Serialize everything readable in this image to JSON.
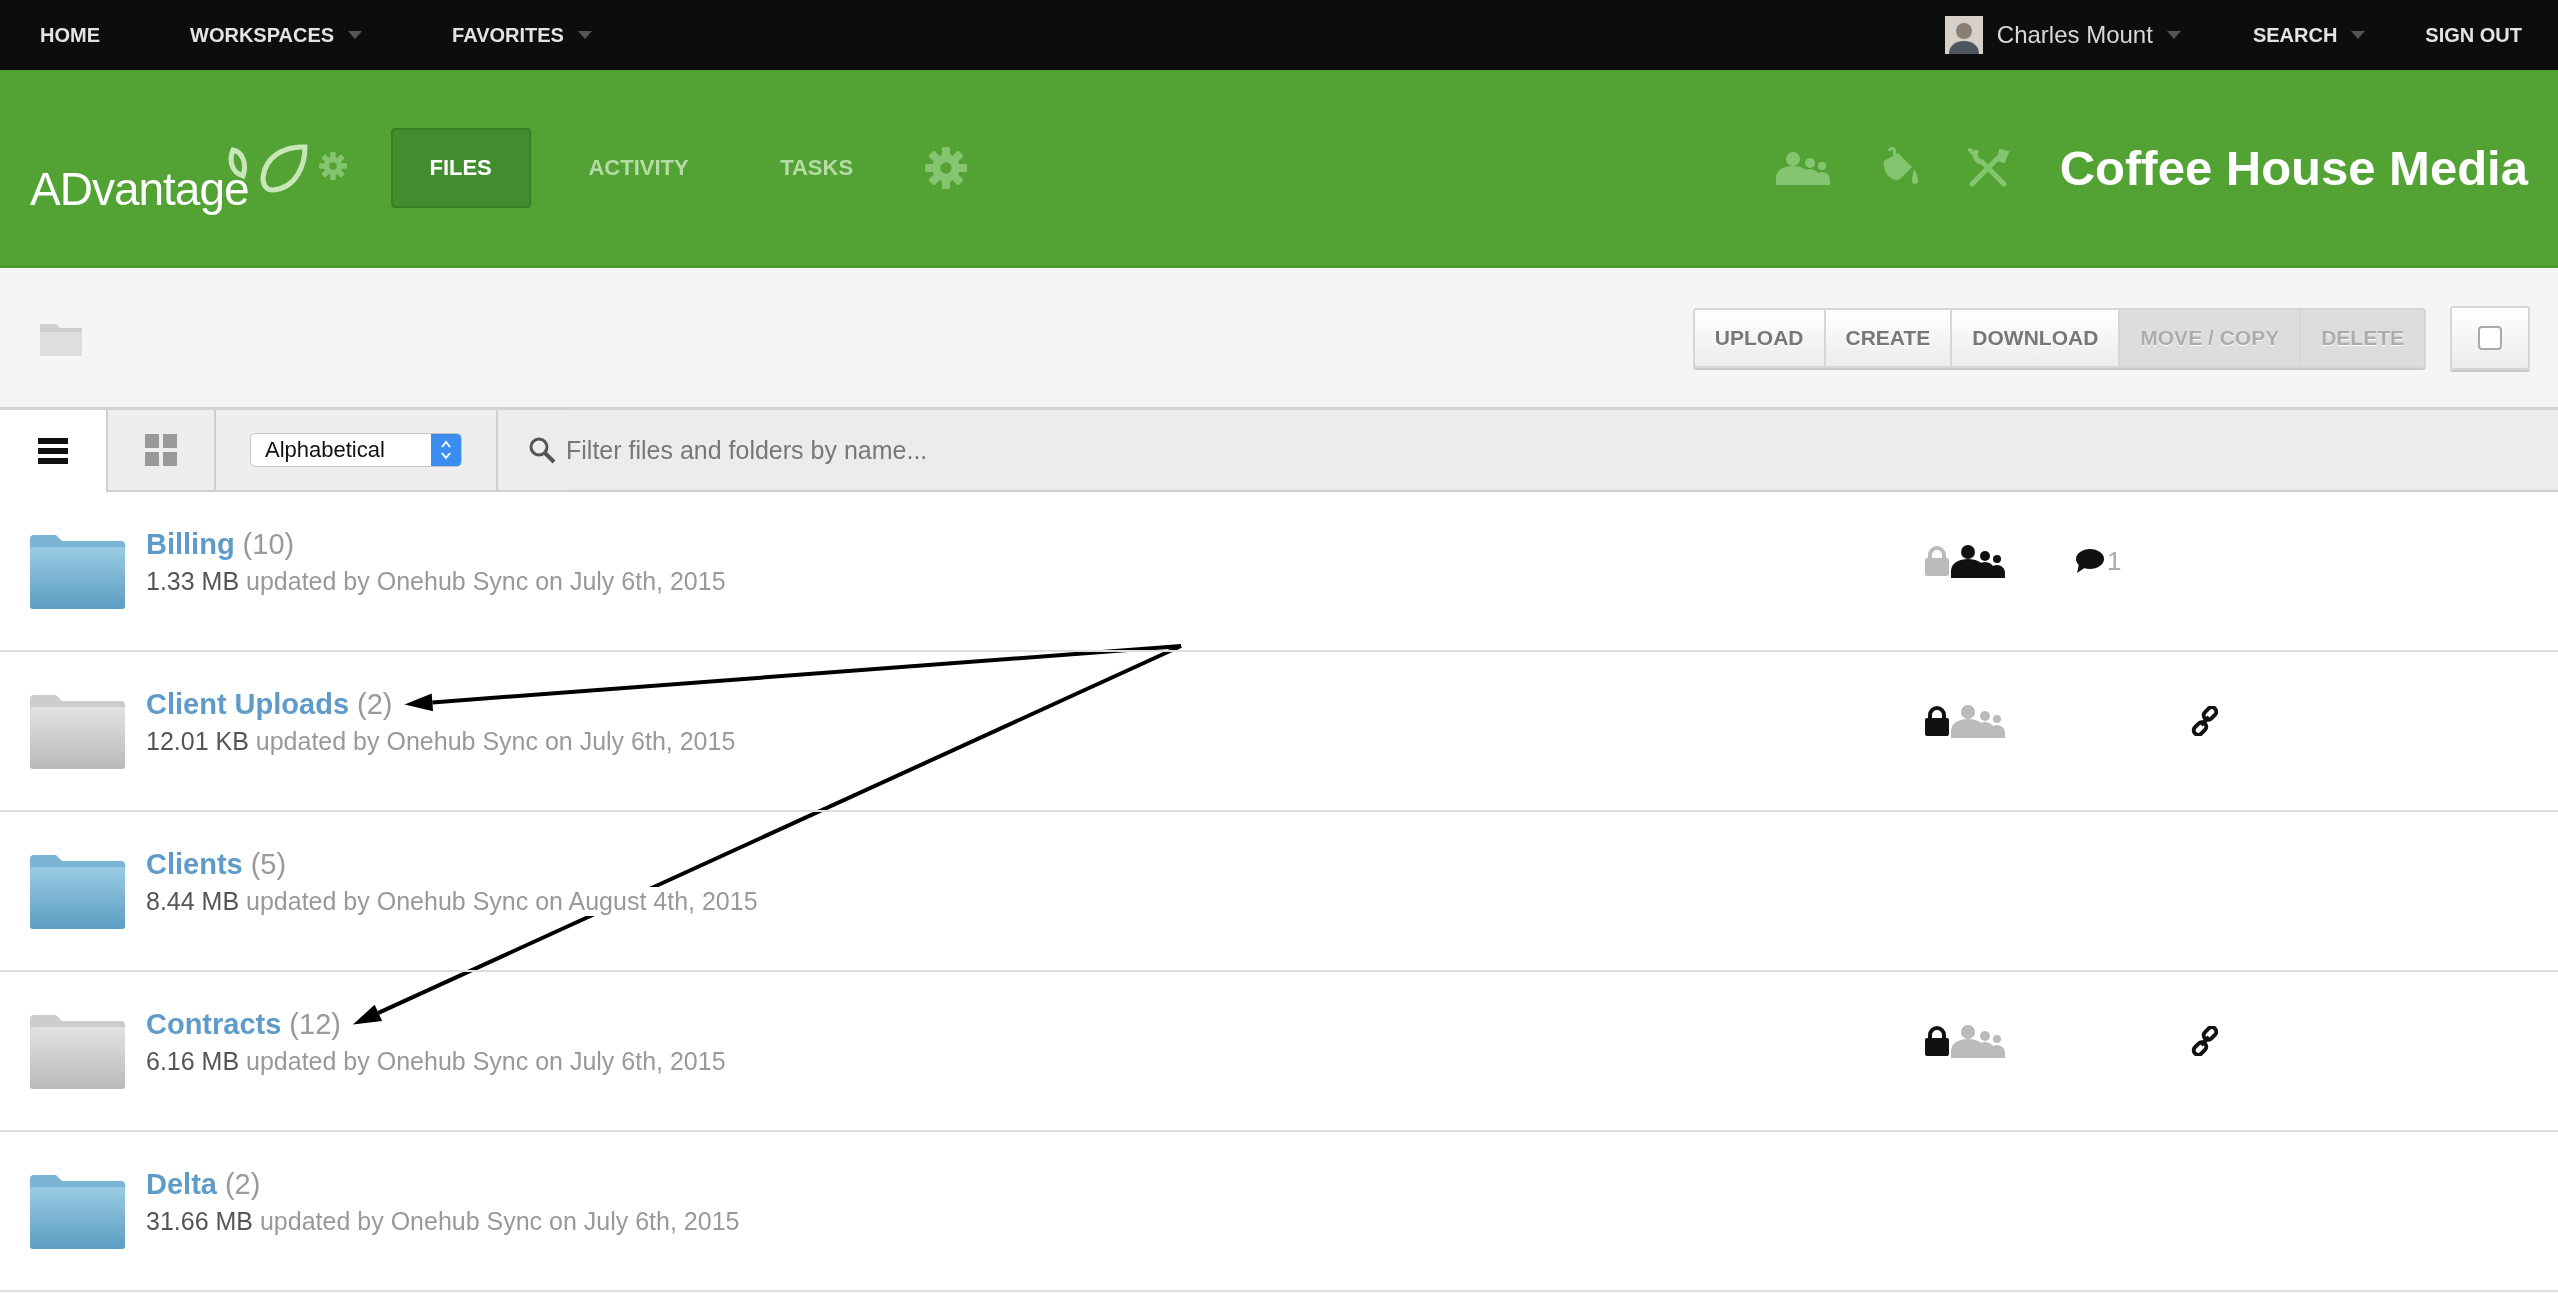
{
  "top_nav": {
    "items": [
      {
        "label": "HOME",
        "dropdown": false
      },
      {
        "label": "WORKSPACES",
        "dropdown": true
      },
      {
        "label": "FAVORITES",
        "dropdown": true
      }
    ],
    "user": {
      "name": "Charles Mount",
      "dropdown": true
    },
    "right_items": [
      {
        "label": "SEARCH",
        "dropdown": true
      },
      {
        "label": "SIGN OUT",
        "dropdown": false
      }
    ]
  },
  "header": {
    "logo": "ADvantage",
    "tabs": [
      {
        "label": "FILES",
        "selected": true
      },
      {
        "label": "ACTIVITY",
        "selected": false
      },
      {
        "label": "TASKS",
        "selected": false
      }
    ],
    "workspace_title": "Coffee House Media"
  },
  "toolbar": {
    "buttons": [
      {
        "label": "UPLOAD",
        "disabled": false
      },
      {
        "label": "CREATE",
        "disabled": false
      },
      {
        "label": "DOWNLOAD",
        "disabled": false
      },
      {
        "label": "MOVE / COPY",
        "disabled": true
      },
      {
        "label": "DELETE",
        "disabled": true
      }
    ],
    "select_all": {
      "checked": false
    }
  },
  "view_bar": {
    "views": [
      {
        "kind": "list",
        "selected": true
      },
      {
        "kind": "grid",
        "selected": false
      }
    ],
    "sort": {
      "value": "Alphabetical"
    },
    "filter": {
      "placeholder": "Filter files and folders by name..."
    }
  },
  "folders": [
    {
      "name": "Billing",
      "count": "(10)",
      "size": "1.33 MB",
      "updated": "updated by Onehub Sync on July 6th, 2015",
      "kind": "shared",
      "permissions": {
        "locked": false,
        "members": true
      },
      "comments": "1"
    },
    {
      "name": "Client Uploads",
      "count": "(2)",
      "size": "12.01 KB",
      "updated": "updated by Onehub Sync on July 6th, 2015",
      "kind": "restricted",
      "permissions": {
        "locked": true,
        "members": false
      },
      "link": true,
      "arrow_pointed": true
    },
    {
      "name": "Clients",
      "count": "(5)",
      "size": "8.44 MB",
      "updated": "updated by Onehub Sync on August 4th, 2015",
      "kind": "shared"
    },
    {
      "name": "Contracts",
      "count": "(12)",
      "size": "6.16 MB",
      "updated": "updated by Onehub Sync on July 6th, 2015",
      "kind": "restricted",
      "permissions": {
        "locked": true,
        "members": false
      },
      "link": true,
      "arrow_pointed": true
    },
    {
      "name": "Delta",
      "count": "(2)",
      "size": "31.66 MB",
      "updated": "updated by Onehub Sync on July 6th, 2015",
      "kind": "shared"
    }
  ]
}
